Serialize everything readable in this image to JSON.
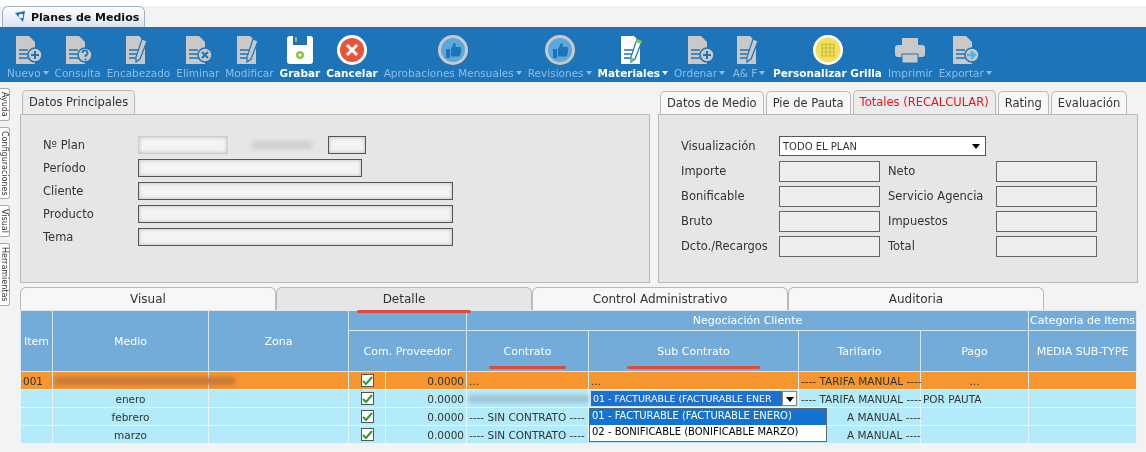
{
  "app_tab": {
    "label": "Planes de Medios"
  },
  "side_tabs": [
    {
      "label": "Ayuda"
    },
    {
      "label": "Configuraciones"
    },
    {
      "label": "Visual"
    },
    {
      "label": "Herramientas"
    }
  ],
  "toolbar": [
    {
      "label": "Nuevo",
      "kind": "doc-plus",
      "enabled": false,
      "menu": true
    },
    {
      "label": "Consulta",
      "kind": "doc-question",
      "enabled": false,
      "menu": false
    },
    {
      "label": "Encabezado",
      "kind": "doc-pencil",
      "enabled": false,
      "menu": false
    },
    {
      "label": "Eliminar",
      "kind": "doc-x",
      "enabled": false,
      "menu": false
    },
    {
      "label": "Modificar",
      "kind": "doc-pencil",
      "enabled": false,
      "menu": false
    },
    {
      "label": "Grabar",
      "kind": "floppy",
      "enabled": true,
      "menu": false
    },
    {
      "label": "Cancelar",
      "kind": "cancel",
      "enabled": true,
      "menu": false
    },
    {
      "label": "Aprobaciones Mensuales",
      "kind": "thumb",
      "enabled": false,
      "menu": true
    },
    {
      "label": "Revisiones",
      "kind": "thumb",
      "enabled": false,
      "menu": true
    },
    {
      "label": "Materiales",
      "kind": "doc-pencil-green",
      "enabled": true,
      "menu": true
    },
    {
      "label": "Ordenar",
      "kind": "doc-plus",
      "enabled": false,
      "menu": true
    },
    {
      "label": "A& F",
      "kind": "doc-pencil",
      "enabled": false,
      "menu": true
    },
    {
      "label": "Personalizar Grilla",
      "kind": "grid",
      "enabled": true,
      "menu": false
    },
    {
      "label": "Imprimir",
      "kind": "printer",
      "enabled": false,
      "menu": false
    },
    {
      "label": "Exportar",
      "kind": "doc-arrow",
      "enabled": false,
      "menu": true
    }
  ],
  "main_panel": {
    "tab": "Datos Principales",
    "fields": [
      {
        "label": "Nº Plan",
        "kind": "plan"
      },
      {
        "label": "Período",
        "kind": "short"
      },
      {
        "label": "Cliente",
        "kind": "long"
      },
      {
        "label": "Producto",
        "kind": "long"
      },
      {
        "label": "Tema",
        "kind": "long"
      }
    ]
  },
  "totals_panel": {
    "tabs": [
      {
        "label": "Datos de Medio",
        "selected": false,
        "alert": false
      },
      {
        "label": "Pie de Pauta",
        "selected": false,
        "alert": false
      },
      {
        "label": "Totales (RECALCULAR)",
        "selected": true,
        "alert": true
      },
      {
        "label": "Rating",
        "selected": false,
        "alert": false
      },
      {
        "label": "Evaluación",
        "selected": false,
        "alert": false
      }
    ],
    "visualizacion": {
      "label": "Visualización",
      "value": "TODO EL PLAN"
    },
    "rows": [
      {
        "left": "Importe",
        "right": "Neto"
      },
      {
        "left": "Bonificable",
        "right": "Servicio Agencia"
      },
      {
        "left": "Bruto",
        "right": "Impuestos"
      },
      {
        "left": "Dcto./Recargos",
        "right": "Total"
      }
    ]
  },
  "detail_tabs": [
    {
      "label": "Visual",
      "selected": false,
      "underlined": false
    },
    {
      "label": "Detalle",
      "selected": true,
      "underlined": true
    },
    {
      "label": "Control Administrativo",
      "selected": false,
      "underlined": false
    },
    {
      "label": "Auditoria",
      "selected": false,
      "underlined": false
    }
  ],
  "grid": {
    "group_1": "Negociación Cliente",
    "group_2": "Categoria de Items",
    "columns": [
      {
        "label": "Item",
        "underlined": false
      },
      {
        "label": "Medio",
        "underlined": false
      },
      {
        "label": "Zona",
        "underlined": false
      },
      {
        "label": "Com. Proveedor",
        "underlined": false
      },
      {
        "label": "Contrato",
        "underlined": true
      },
      {
        "label": "Sub Contrato",
        "underlined": true
      },
      {
        "label": "Tarifario",
        "underlined": false
      },
      {
        "label": "Pago",
        "underlined": false
      },
      {
        "label": "MEDIA SUB-TYPE",
        "underlined": false
      }
    ],
    "rows": [
      {
        "kind": "item",
        "item": "001",
        "medio": "",
        "com_checked": true,
        "com_value": "0.0000",
        "contrato": "...",
        "sub_contrato": "...",
        "tarifario": "---- TARIFA MANUAL ----",
        "pago": "..."
      },
      {
        "kind": "month",
        "item": "",
        "medio": "enero",
        "com_checked": true,
        "com_value": "0.0000",
        "contrato": "",
        "sub_contrato": "01 - FACTURABLE (FACTURABLE ENER",
        "tarifario": "---- TARIFA MANUAL ----",
        "pago": "POR PAUTA",
        "options": [
          {
            "label": "01 - FACTURABLE (FACTURABLE ENERO)",
            "selected": true
          },
          {
            "label": "02 - BONIFICABLE (BONIFICABLE MARZO)",
            "selected": false
          }
        ]
      },
      {
        "kind": "month",
        "item": "",
        "medio": "febrero",
        "com_checked": true,
        "com_value": "0.0000",
        "contrato": "---- SIN CONTRATO ----",
        "sub_contrato": "",
        "tarifario": "A MANUAL ----",
        "pago": ""
      },
      {
        "kind": "month",
        "item": "",
        "medio": "marzo",
        "com_checked": true,
        "com_value": "0.0000",
        "contrato": "---- SIN CONTRATO ----",
        "sub_contrato": "",
        "tarifario": "A MANUAL ----",
        "pago": ""
      }
    ]
  }
}
